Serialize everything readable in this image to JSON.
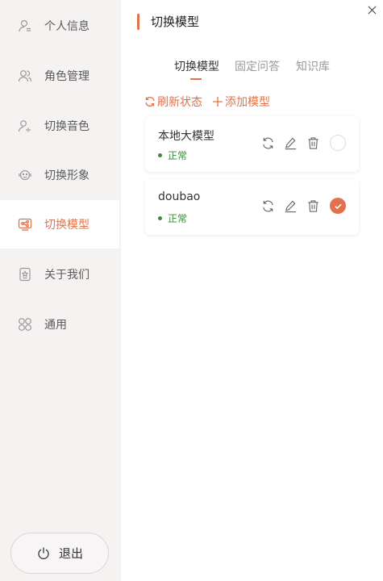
{
  "sidebar": {
    "items": [
      {
        "label": "个人信息",
        "icon": "user-icon"
      },
      {
        "label": "角色管理",
        "icon": "users-icon"
      },
      {
        "label": "切换音色",
        "icon": "voice-icon"
      },
      {
        "label": "切换形象",
        "icon": "avatar-icon"
      },
      {
        "label": "切换模型",
        "icon": "model-icon",
        "active": true
      },
      {
        "label": "关于我们",
        "icon": "badge-icon"
      },
      {
        "label": "通用",
        "icon": "grid-icon"
      }
    ],
    "logout_label": "退出"
  },
  "header": {
    "title": "切换模型"
  },
  "tabs": [
    {
      "label": "切换模型",
      "active": true
    },
    {
      "label": "固定问答"
    },
    {
      "label": "知识库"
    }
  ],
  "actions": {
    "refresh_label": "刷新状态",
    "add_label": "添加模型"
  },
  "models": [
    {
      "name": "本地大模型",
      "status": "正常",
      "selected": false
    },
    {
      "name": "doubao",
      "status": "正常",
      "selected": true
    }
  ],
  "colors": {
    "accent": "#e0734d",
    "status_ok": "#3b8a3b",
    "sidebar_bg": "#f5f2f2"
  }
}
